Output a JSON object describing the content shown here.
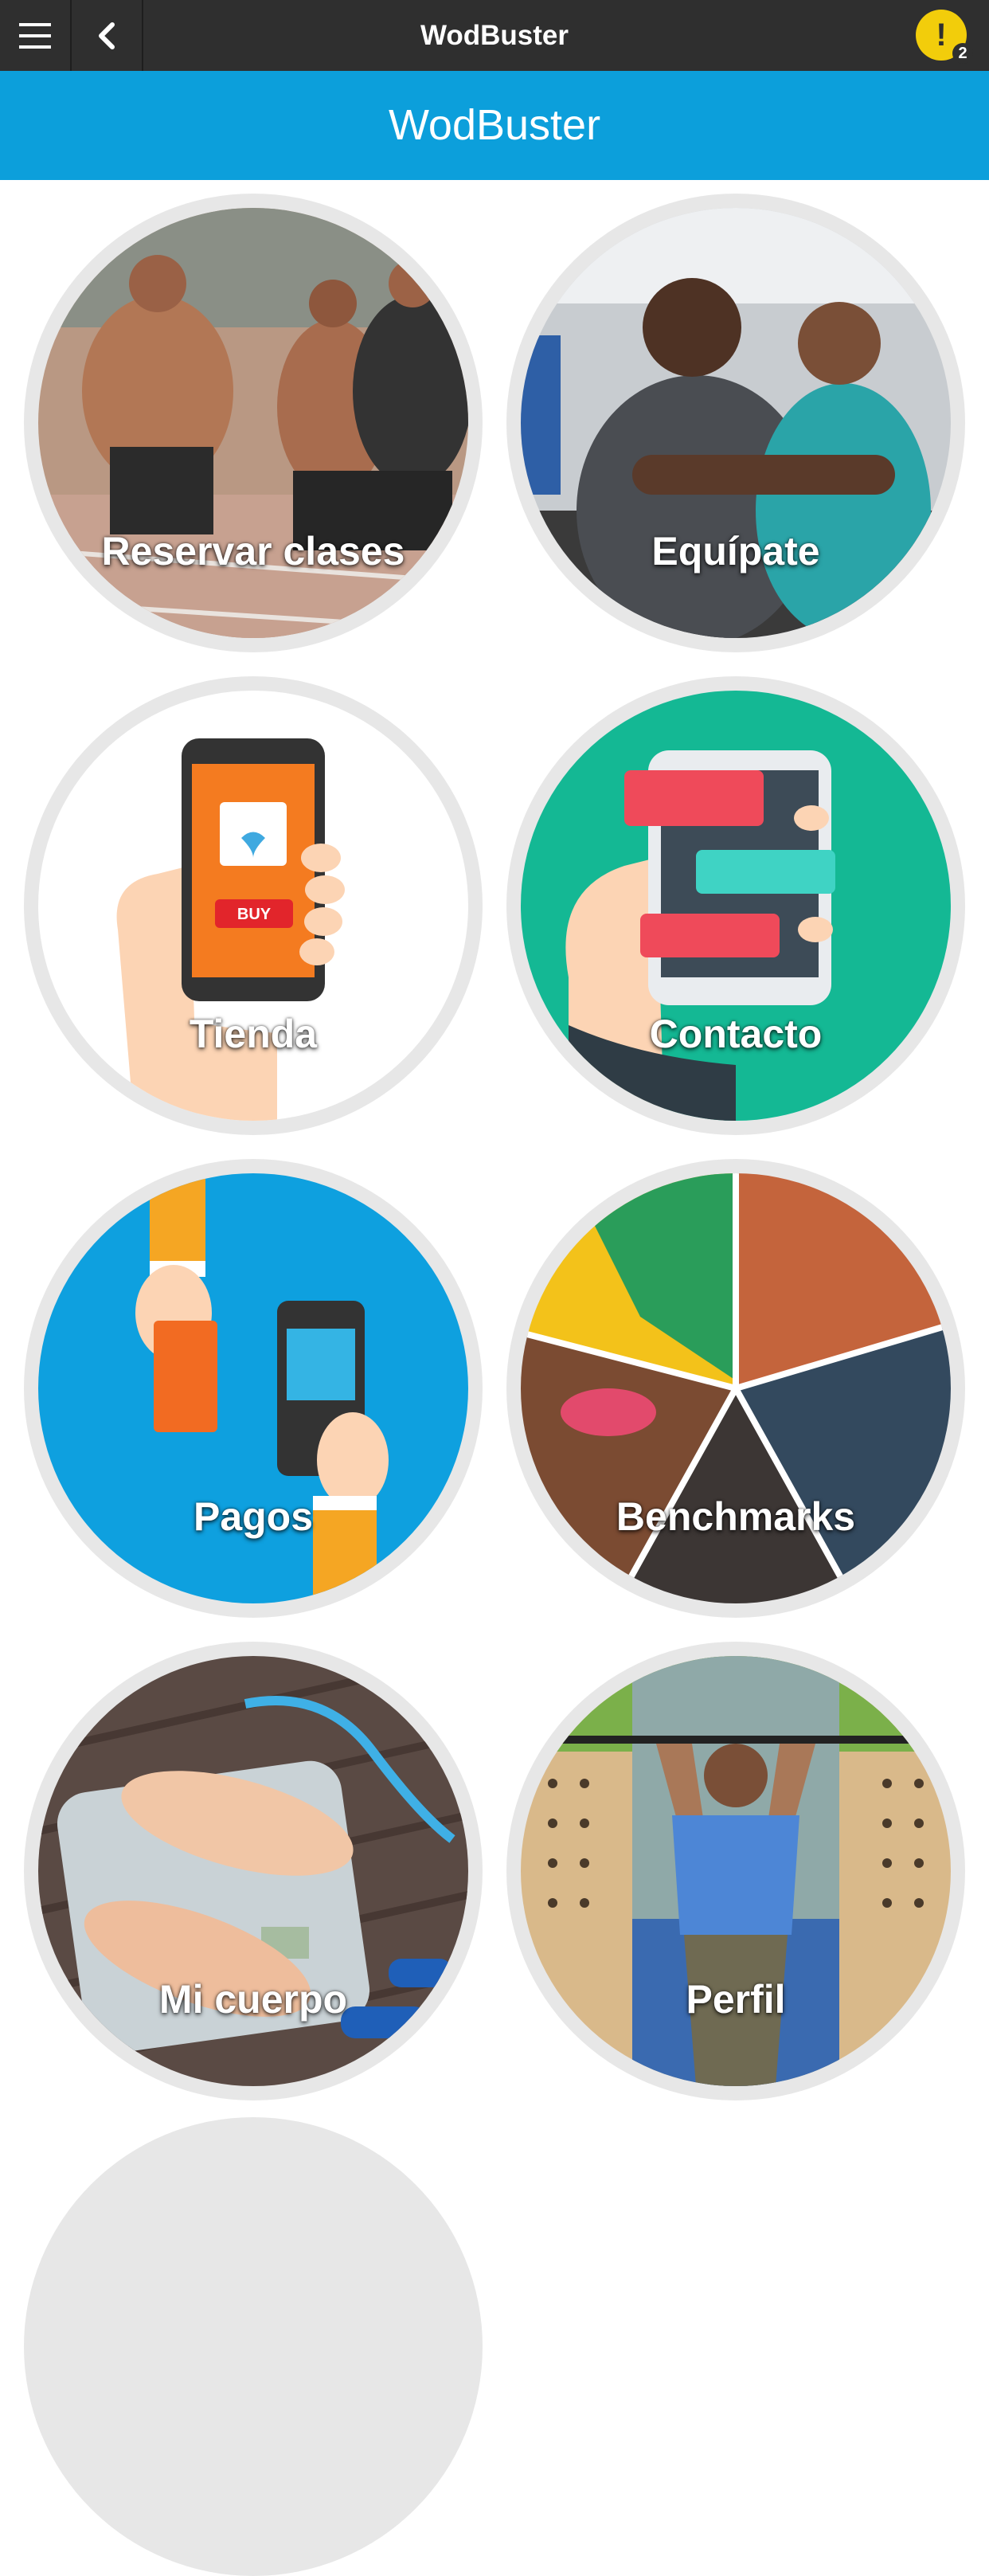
{
  "app": {
    "title": "WodBuster"
  },
  "topbar": {
    "menu_icon": "menu-icon",
    "back_icon": "chevron-left-icon",
    "title": "WodBuster",
    "alert_icon": "exclamation-icon",
    "alert_count": "2"
  },
  "banner": {
    "title": "WodBuster"
  },
  "colors": {
    "topbar": "#2f2f2f",
    "banner": "#0c9fdb",
    "alert": "#f2cd0b",
    "tile_ring": "#e7e7e7"
  },
  "tiles": [
    {
      "label": "Reservar clases",
      "image": "athletes-running-photo"
    },
    {
      "label": "Equípate",
      "image": "smiling-couple-gym-photo"
    },
    {
      "label": "Tienda",
      "image": "hand-phone-shop-illustration"
    },
    {
      "label": "Contacto",
      "image": "hand-phone-chat-illustration"
    },
    {
      "label": "Pagos",
      "image": "card-payment-illustration"
    },
    {
      "label": "Benchmarks",
      "image": "sports-collage"
    },
    {
      "label": "Mi cuerpo",
      "image": "feet-on-scale-photo"
    },
    {
      "label": "Perfil",
      "image": "pullup-athlete-photo"
    }
  ]
}
